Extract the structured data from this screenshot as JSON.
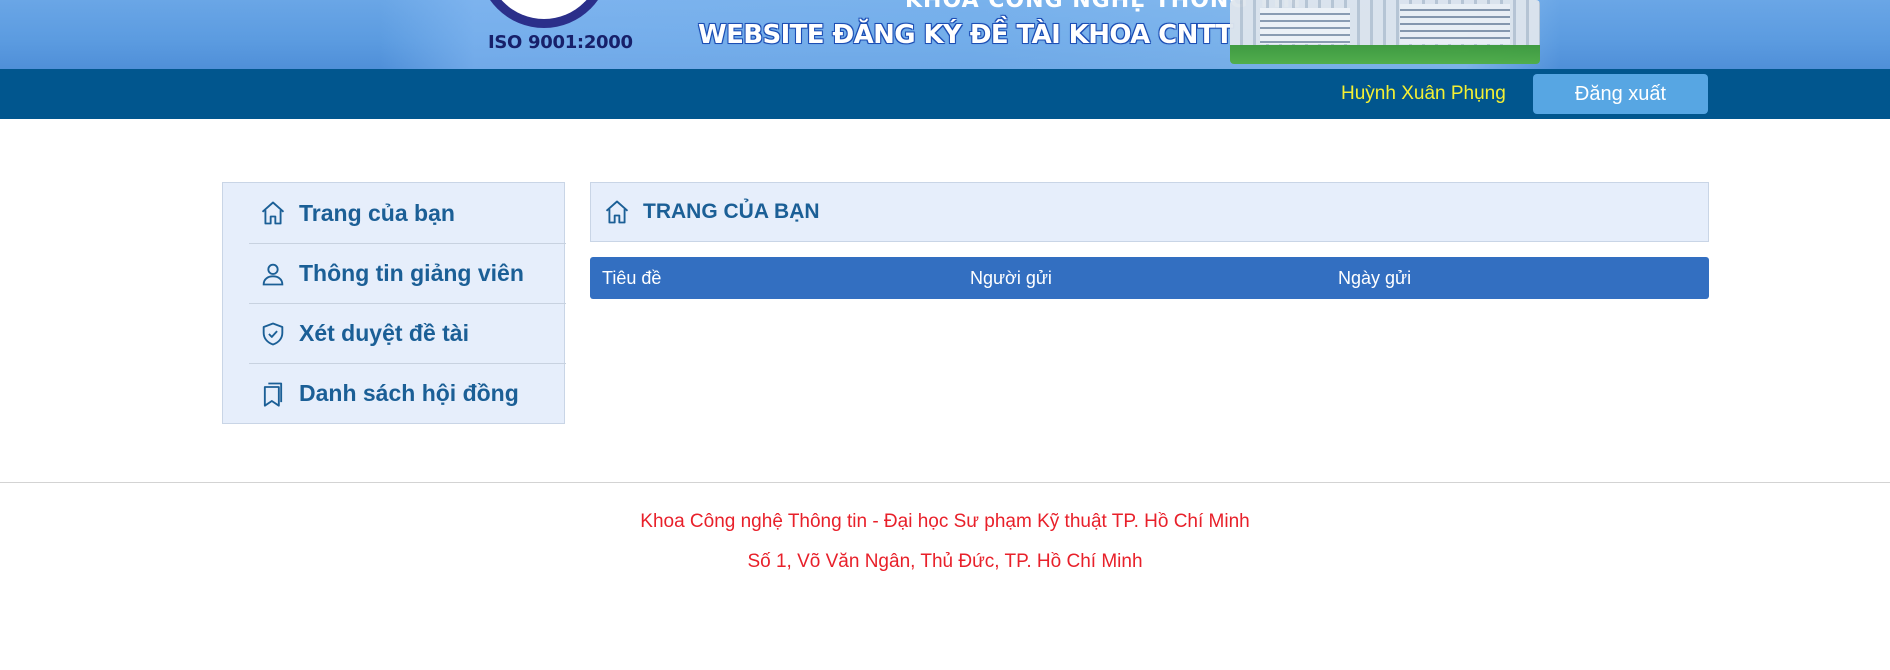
{
  "banner": {
    "iso": "ISO 9001:2000",
    "subtitle_top": "KHOA CÔNG NGHỆ THÔNG TIN",
    "title": "WEBSITE ĐĂNG KÝ ĐỀ TÀI KHOA CNTT"
  },
  "nav": {
    "user_name": "Huỳnh Xuân Phụng",
    "logout_label": "Đăng xuất"
  },
  "sidebar": {
    "items": [
      {
        "label": "Trang của bạn",
        "icon": "home-icon"
      },
      {
        "label": "Thông tin giảng viên",
        "icon": "user-icon"
      },
      {
        "label": "Xét duyệt đề tài",
        "icon": "shield-check-icon"
      },
      {
        "label": "Danh sách hội đồng",
        "icon": "bookmarks-icon"
      }
    ]
  },
  "main": {
    "page_title": "TRANG CỦA BẠN",
    "table": {
      "columns": [
        "Tiêu đề",
        "Người gửi",
        "Ngày gửi"
      ],
      "rows": []
    }
  },
  "footer": {
    "line1": "Khoa Công nghệ Thông tin - Đại học Sư phạm Kỹ thuật TP. Hồ Chí Minh",
    "line2": "Số 1, Võ Văn Ngân, Thủ Đức, TP. Hồ Chí Minh"
  },
  "colors": {
    "navbar": "#01568e",
    "accent": "#336fc1",
    "panel": "#e6eefb",
    "link_text": "#1b5f96",
    "footer_text": "#e8202a",
    "user_name": "#f5f033"
  }
}
